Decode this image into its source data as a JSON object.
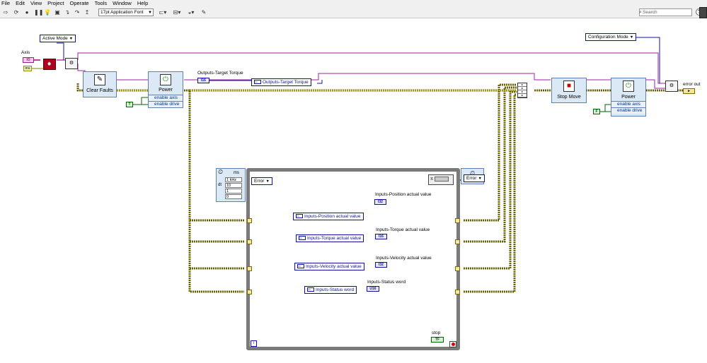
{
  "menu": [
    "File",
    "Edit",
    "View",
    "Project",
    "Operate",
    "Tools",
    "Window",
    "Help"
  ],
  "toolbar": {
    "font": "17pt Application Font",
    "search_placeholder": "Search",
    "help": "?"
  },
  "diagram": {
    "axis_label": "Axis",
    "ms_label": "ms",
    "active_mode": "Active Mode",
    "config_mode": "Configuration Mode",
    "clear_faults": "Clear Faults",
    "power1": {
      "name": "Power",
      "row1": "enable axis",
      "row2": "enable drive",
      "bool": "T"
    },
    "power2": {
      "name": "Power",
      "row1": "enable axis",
      "row2": "enable drive",
      "bool": "F"
    },
    "stop_move": "Stop Move",
    "target_torque_label": "Outputs-Target Torque",
    "target_torque_node": "Outputs-Target Torque",
    "target_torque_type": "I16",
    "error_out": "error out",
    "error_in": "Error",
    "error_out_loop": "Error",
    "timing": {
      "ms": "ms",
      "rows": [
        "1 kHz",
        "10",
        "1",
        "0"
      ],
      "labels": [
        "",
        "dt",
        "",
        ""
      ]
    },
    "inputs": [
      {
        "label": "Inputs-Position actual value",
        "node": "Inputs-Position actual value",
        "type": "I32"
      },
      {
        "label": "Inputs-Torque actual value",
        "node": "Inputs-Torque actual value",
        "type": "I16"
      },
      {
        "label": "Inputs-Velocity actual value",
        "node": "Inputs-Velocity actual value",
        "type": "I32"
      },
      {
        "label": "Inputs-Status word",
        "node": "Inputs-Status word",
        "type": "U16"
      }
    ],
    "stop_label": "stop",
    "stop_term": "TF",
    "iter": "i",
    "ev": "Ev"
  }
}
